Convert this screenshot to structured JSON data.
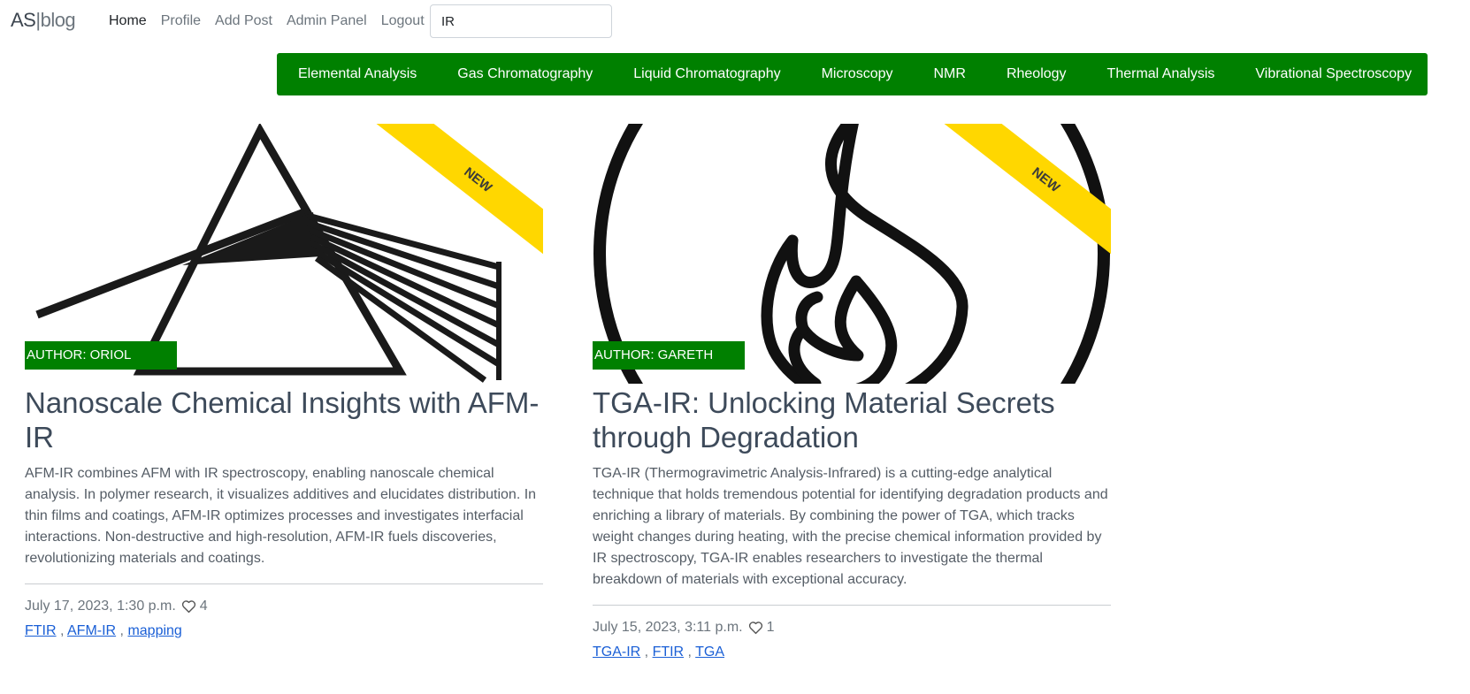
{
  "brand": {
    "strong": "AS",
    "sep": "|",
    "rest": "blog"
  },
  "nav": {
    "items": [
      {
        "label": "Home",
        "active": true
      },
      {
        "label": "Profile"
      },
      {
        "label": "Add Post"
      },
      {
        "label": "Admin Panel"
      },
      {
        "label": "Logout"
      }
    ]
  },
  "search": {
    "value": "IR"
  },
  "categories": [
    "Elemental Analysis",
    "Gas Chromatography",
    "Liquid Chromatography",
    "Microscopy",
    "NMR",
    "Rheology",
    "Thermal Analysis",
    "Vibrational Spectroscopy"
  ],
  "posts": [
    {
      "ribbon": "NEW",
      "author": "AUTHOR: ORIOL",
      "image_icon": "prism-icon",
      "title": "Nanoscale Chemical Insights with AFM-IR",
      "excerpt": "AFM-IR combines AFM with IR spectroscopy, enabling nanoscale chemical analysis. In polymer research, it visualizes additives and elucidates distribution. In thin films and coatings, AFM-IR optimizes processes and investigates interfacial interactions. Non-destructive and high-resolution, AFM-IR fuels discoveries, revolutionizing materials and coatings.",
      "date": "July 17, 2023, 1:30 p.m.",
      "likes": "4",
      "tags": [
        "FTIR",
        "AFM-IR",
        "mapping"
      ]
    },
    {
      "ribbon": "NEW",
      "author": "AUTHOR: GARETH",
      "image_icon": "flame-icon",
      "title": "TGA-IR: Unlocking Material Secrets through Degradation",
      "excerpt": "TGA-IR (Thermogravimetric Analysis-Infrared) is a cutting-edge analytical technique that holds tremendous potential for identifying degradation products and enriching a library of materials. By combining the power of TGA, which tracks weight changes during heating, with the precise chemical information provided by IR spectroscopy, TGA-IR enables researchers to investigate the thermal breakdown of materials with exceptional accuracy.",
      "date": "July 15, 2023, 3:11 p.m.",
      "likes": "1",
      "tags": [
        "TGA-IR",
        "FTIR",
        "TGA"
      ]
    }
  ],
  "colors": {
    "accent_green": "#008000",
    "ribbon_yellow": "#ffd700",
    "link_blue": "#1a5fd6"
  }
}
